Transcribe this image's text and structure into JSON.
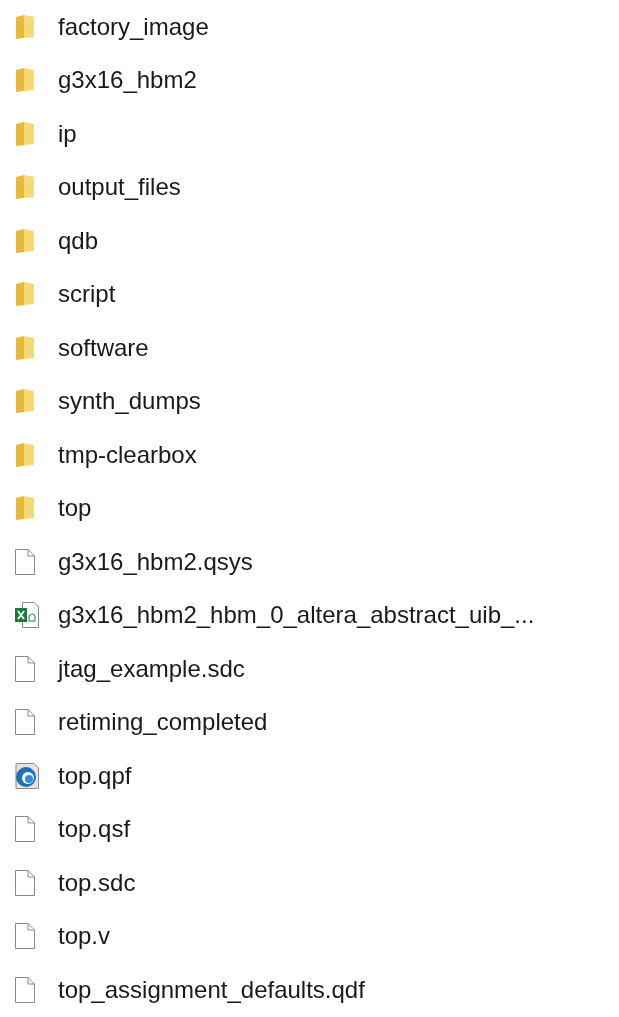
{
  "items": [
    {
      "kind": "folder",
      "name": "factory_image"
    },
    {
      "kind": "folder",
      "name": "g3x16_hbm2"
    },
    {
      "kind": "folder",
      "name": "ip"
    },
    {
      "kind": "folder",
      "name": "output_files"
    },
    {
      "kind": "folder",
      "name": "qdb"
    },
    {
      "kind": "folder",
      "name": "script"
    },
    {
      "kind": "folder",
      "name": "software"
    },
    {
      "kind": "folder",
      "name": "synth_dumps"
    },
    {
      "kind": "folder",
      "name": "tmp-clearbox"
    },
    {
      "kind": "folder",
      "name": "top"
    },
    {
      "kind": "file",
      "name": "g3x16_hbm2.qsys"
    },
    {
      "kind": "spreadsheet",
      "name": "g3x16_hbm2_hbm_0_altera_abstract_uib_..."
    },
    {
      "kind": "file",
      "name": "jtag_example.sdc"
    },
    {
      "kind": "file",
      "name": "retiming_completed"
    },
    {
      "kind": "project",
      "name": "top.qpf"
    },
    {
      "kind": "file",
      "name": "top.qsf"
    },
    {
      "kind": "file",
      "name": "top.sdc"
    },
    {
      "kind": "file",
      "name": "top.v"
    },
    {
      "kind": "file",
      "name": "top_assignment_defaults.qdf"
    }
  ]
}
